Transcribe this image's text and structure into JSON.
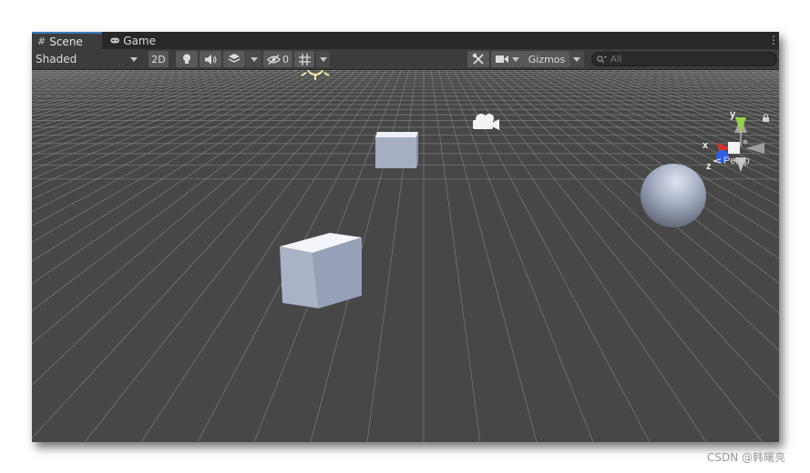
{
  "tabs": [
    {
      "label": "Scene",
      "icon": "grid-icon",
      "active": true
    },
    {
      "label": "Game",
      "icon": "gamepad-icon",
      "active": false
    }
  ],
  "toolbar": {
    "shading_mode": "Shaded",
    "toggle_2d": "2D",
    "hidden_count": "0",
    "gizmos_label": "Gizmos",
    "search_placeholder": "All"
  },
  "scene": {
    "projection_label": "Persp",
    "axis_x": "x",
    "axis_y": "y",
    "axis_z": "z"
  },
  "watermark": "CSDN @韩曙亮",
  "colors": {
    "tab_accent": "#3a79bb",
    "viewport_bg": "#474747",
    "axis_x": "#d3322c",
    "axis_y": "#78c53a",
    "axis_z": "#2f5fe0"
  }
}
